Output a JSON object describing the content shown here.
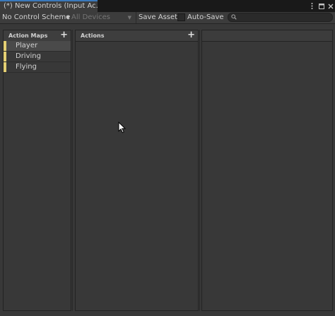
{
  "tab": {
    "title": "(*) New Controls (Input Ac...",
    "tools": [
      "more-menu-icon",
      "maximize-icon",
      "close-icon"
    ]
  },
  "toolbar": {
    "control_scheme": "No Control Scheme",
    "devices": "All Devices",
    "save_asset": "Save Asset",
    "auto_save": "Auto-Save",
    "auto_save_checked": false,
    "search_value": ""
  },
  "action_maps": {
    "header": "Action Maps",
    "items": [
      {
        "label": "Player",
        "selected": true
      },
      {
        "label": "Driving",
        "selected": false
      },
      {
        "label": "Flying",
        "selected": false
      }
    ]
  },
  "actions": {
    "header": "Actions",
    "items": []
  },
  "colors": {
    "accent_tab": "#3a79bb",
    "map_stripe": "#e4cf73",
    "background": "#383838"
  }
}
